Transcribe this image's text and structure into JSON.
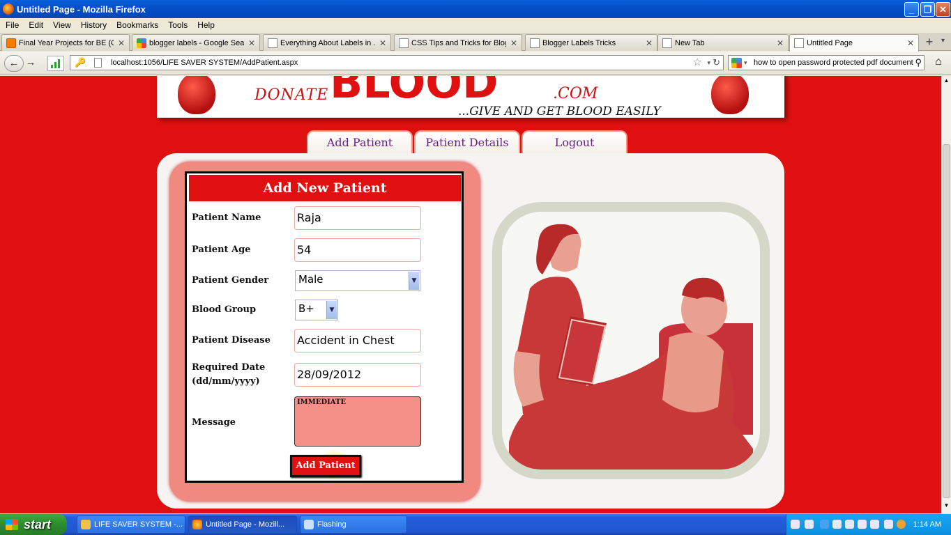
{
  "window": {
    "title": "Untitled Page - Mozilla Firefox"
  },
  "menu": [
    "File",
    "Edit",
    "View",
    "History",
    "Bookmarks",
    "Tools",
    "Help"
  ],
  "tabs": [
    {
      "label": "Final Year Projects for BE (C...",
      "icon": "blogger-icon"
    },
    {
      "label": "blogger labels - Google Search",
      "icon": "google-icon"
    },
    {
      "label": "Everything About Labels in ...",
      "icon": "page-icon"
    },
    {
      "label": "CSS Tips and Tricks for Blog...",
      "icon": "page-icon"
    },
    {
      "label": "Blogger Labels Tricks",
      "icon": "page-icon"
    },
    {
      "label": "New Tab",
      "icon": "page-icon"
    },
    {
      "label": "Untitled Page",
      "icon": "page-icon",
      "active": true
    }
  ],
  "address": {
    "url": "localhost:1056/LIFE SAVER SYSTEM/AddPatient.aspx"
  },
  "search": {
    "value": "how to open password protected pdf document"
  },
  "banner": {
    "donate": "DONATE",
    "blood": "BLOOD",
    "domain": ".COM",
    "tagline": "...GIVE AND GET BLOOD EASILY"
  },
  "nav": [
    "Add Patient",
    "Patient Details",
    "Logout"
  ],
  "form": {
    "heading": "Add New Patient",
    "fields": {
      "name": {
        "label": "Patient Name",
        "value": "Raja"
      },
      "age": {
        "label": "Patient Age",
        "value": "54"
      },
      "gender": {
        "label": "Patient Gender",
        "value": "Male"
      },
      "blood": {
        "label": "Blood Group",
        "value": "B+"
      },
      "disease": {
        "label": "Patient Disease",
        "value": "Accident in Chest"
      },
      "date": {
        "label": "Required Date",
        "label2": "(dd/mm/yyyy)",
        "value": "28/09/2012"
      },
      "message": {
        "label": "Message",
        "value": "IMMEDIATE"
      }
    },
    "submit": "Add Patient"
  },
  "taskbar": {
    "start": "start",
    "tasks": [
      "LIFE SAVER SYSTEM -...",
      "Untitled Page - Mozill...",
      "Flashing"
    ],
    "clock": "1:14 AM"
  },
  "colors": {
    "page_bg": "#e01010",
    "accent_purple": "#6a1e8c",
    "form_frame": "#f08a80"
  }
}
